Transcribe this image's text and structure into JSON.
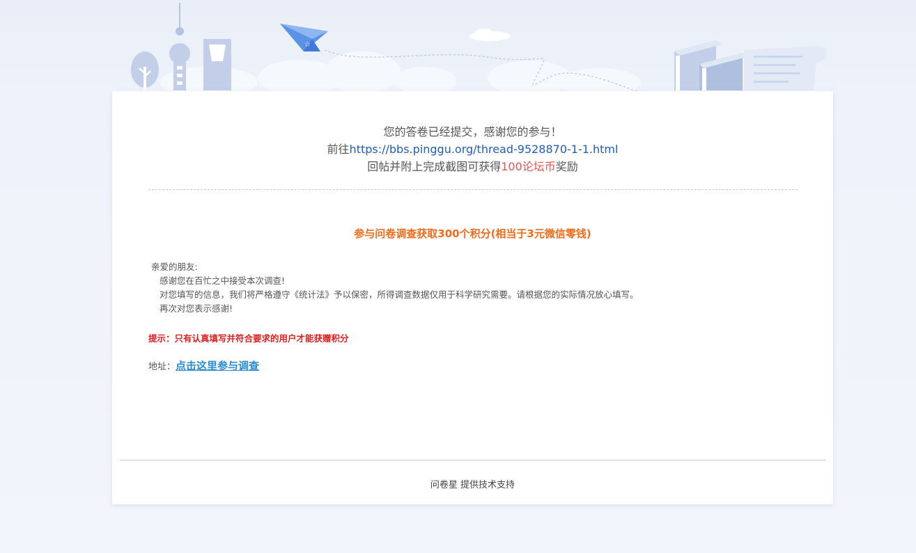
{
  "result": {
    "line1": "您的答卷已经提交，感谢您的参与！",
    "line2_prefix": "前往",
    "line2_link": "https://bbs.pinggu.org/thread-9528870-1-1.html",
    "line3_prefix": "回帖并附上完成截图可获得",
    "line3_reward": "100论坛币",
    "line3_suffix": "奖励"
  },
  "survey": {
    "title": "参与问卷调查获取300个积分(相当于3元微信零钱)",
    "greeting": "亲爱的朋友:",
    "para1": "感谢您在百忙之中接受本次调查!",
    "para2": "对您填写的信息，我们将严格遵守《统计法》予以保密，所得调查数据仅用于科学研究需要。请根据您的实际情况放心填写。",
    "para3": "再次对您表示感谢!",
    "notice": "提示：只有认真填写并符合要求的用户才能获赠积分",
    "address_label": "地址：",
    "address_link": "点击这里参与调查"
  },
  "footer": {
    "text": "问卷星 提供技术支持"
  },
  "colors": {
    "accent_orange": "#f26b1a",
    "notice_red": "#e0201f",
    "link_blue": "#1f5fb4",
    "survey_link_blue": "#2a8bd0",
    "reward_red": "#e8554e"
  },
  "icons": [
    "tree-icon",
    "tv-tower-icon",
    "skyscraper-icon",
    "paper-plane-icon",
    "cloud-icon",
    "books-icon",
    "paper-scroll-icon"
  ]
}
